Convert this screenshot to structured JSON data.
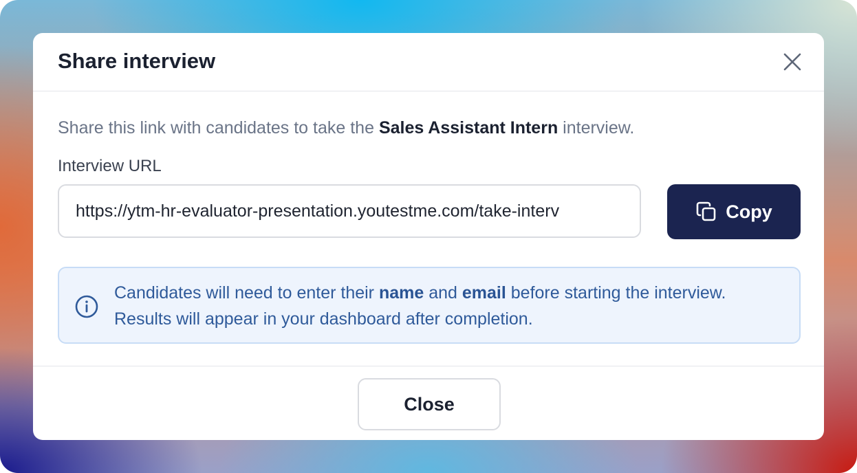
{
  "dialog": {
    "title": "Share interview",
    "description_prefix": "Share this link with candidates to take the ",
    "position_name": "Sales Assistant Intern",
    "description_suffix": " interview.",
    "url_label": "Interview URL",
    "url_value": "https://ytm-hr-evaluator-presentation.youtestme.com/take-interv",
    "copy_label": "Copy",
    "info": {
      "line1_part1": "Candidates will need to enter their ",
      "line1_name": "name",
      "line1_and": " and ",
      "line1_email": "email",
      "line1_part2": " before starting the interview.",
      "line2": "Results will appear in your dashboard after completion."
    },
    "close_label": "Close"
  },
  "icons": {
    "close": "close-icon",
    "copy": "copy-icon",
    "info": "info-icon"
  },
  "colors": {
    "primary_button": "#1b2450",
    "info_background": "#eef4fd",
    "info_text": "#2f5a9a"
  }
}
